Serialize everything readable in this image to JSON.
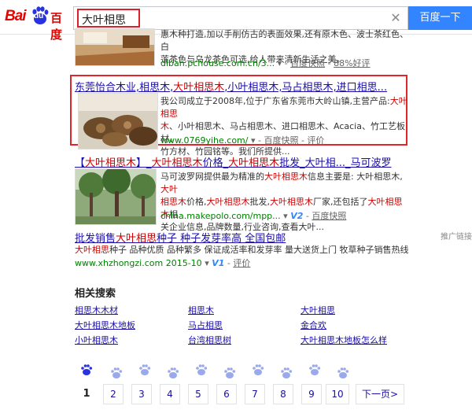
{
  "header": {
    "logo_bai": "Bai",
    "logo_du": "du",
    "logo_cn": "百度",
    "search_value": "大叶相思木",
    "search_button": "百度一下"
  },
  "results": [
    {
      "title_partial": "",
      "desc_lines": [
        "惠木种打造,加以手削仿古的表面效果,还有原木色、波士茶红色、白",
        "莲茶色与乌龙茶色可选,给人带来清新生活之美。"
      ],
      "url": "diban.pchouse.com.cn/3...",
      "cache": "百度快照",
      "rate": "88%好评"
    },
    {
      "title_parts": [
        "东莞怡合木业,相思木,",
        "大叶相思木",
        ",小叶相思木,马占相思木,进口相思..."
      ],
      "desc_lines": [
        [
          "我公司成立于2008年,位于广东省东莞市大岭山镇,主营产品:",
          "大叶相思",
          ""
        ],
        [
          "",
          "木",
          "、小叶相思木、马占相思木、进口相思木、Acacia、竹工艺板材、"
        ],
        [
          "竹方材、竹фу",
          "",
          ""
        ],
        [
          "竹方材、竹园铭等。我们所提供...",
          "",
          ""
        ]
      ],
      "url": "www.0769yihe.com/",
      "cache": "百度快照",
      "rate": "评价"
    },
    {
      "title_parts": [
        "【",
        "大叶相思木",
        "】_",
        "大叶相思木",
        "价格_",
        "大叶相思木",
        "批发_大叶相..._马可波罗"
      ],
      "desc_lines": [
        [
          "马可波罗网提供最为精准的",
          "大叶相思木",
          "信息主要是: 大叶相思木,",
          "大叶"
        ],
        [
          "相思木",
          "价格,",
          "大叶相思木",
          "批发,",
          "大叶相思木",
          "厂家,还包括了",
          "大叶相思木",
          "相"
        ],
        [
          "关企业信息,品牌数量,行业咨询,查看大叶..."
        ]
      ],
      "url": "china.makepolo.com/mpp...",
      "cache": "百度快照",
      "badge": "V2"
    },
    {
      "title_parts": [
        "批发销售",
        "大叶相思",
        "种子 种子发芽率高 全国包邮"
      ],
      "desc_lines": [
        [
          "大叶相思",
          "种子 品种优质 品种繁多 保证成活率和发芽率 量大送货上门 牧草种子销售热线"
        ]
      ],
      "url": "www.xhzhongzi.com",
      "date": "2015-10",
      "badge": "V1",
      "rate": "评价",
      "ad": "推广链接"
    }
  ],
  "related": {
    "title": "相关搜索",
    "items": [
      "相思木木材",
      "相思木",
      "大叶相思",
      "大叶相思木地板",
      "马占相思",
      "金合欢",
      "小叶相思木",
      "台湾相思树",
      "大叶相思木地板怎么样"
    ]
  },
  "pagination": {
    "current": "1",
    "pages": [
      "2",
      "3",
      "4",
      "5",
      "6",
      "7",
      "8",
      "9",
      "10"
    ],
    "next": "下一页>"
  }
}
